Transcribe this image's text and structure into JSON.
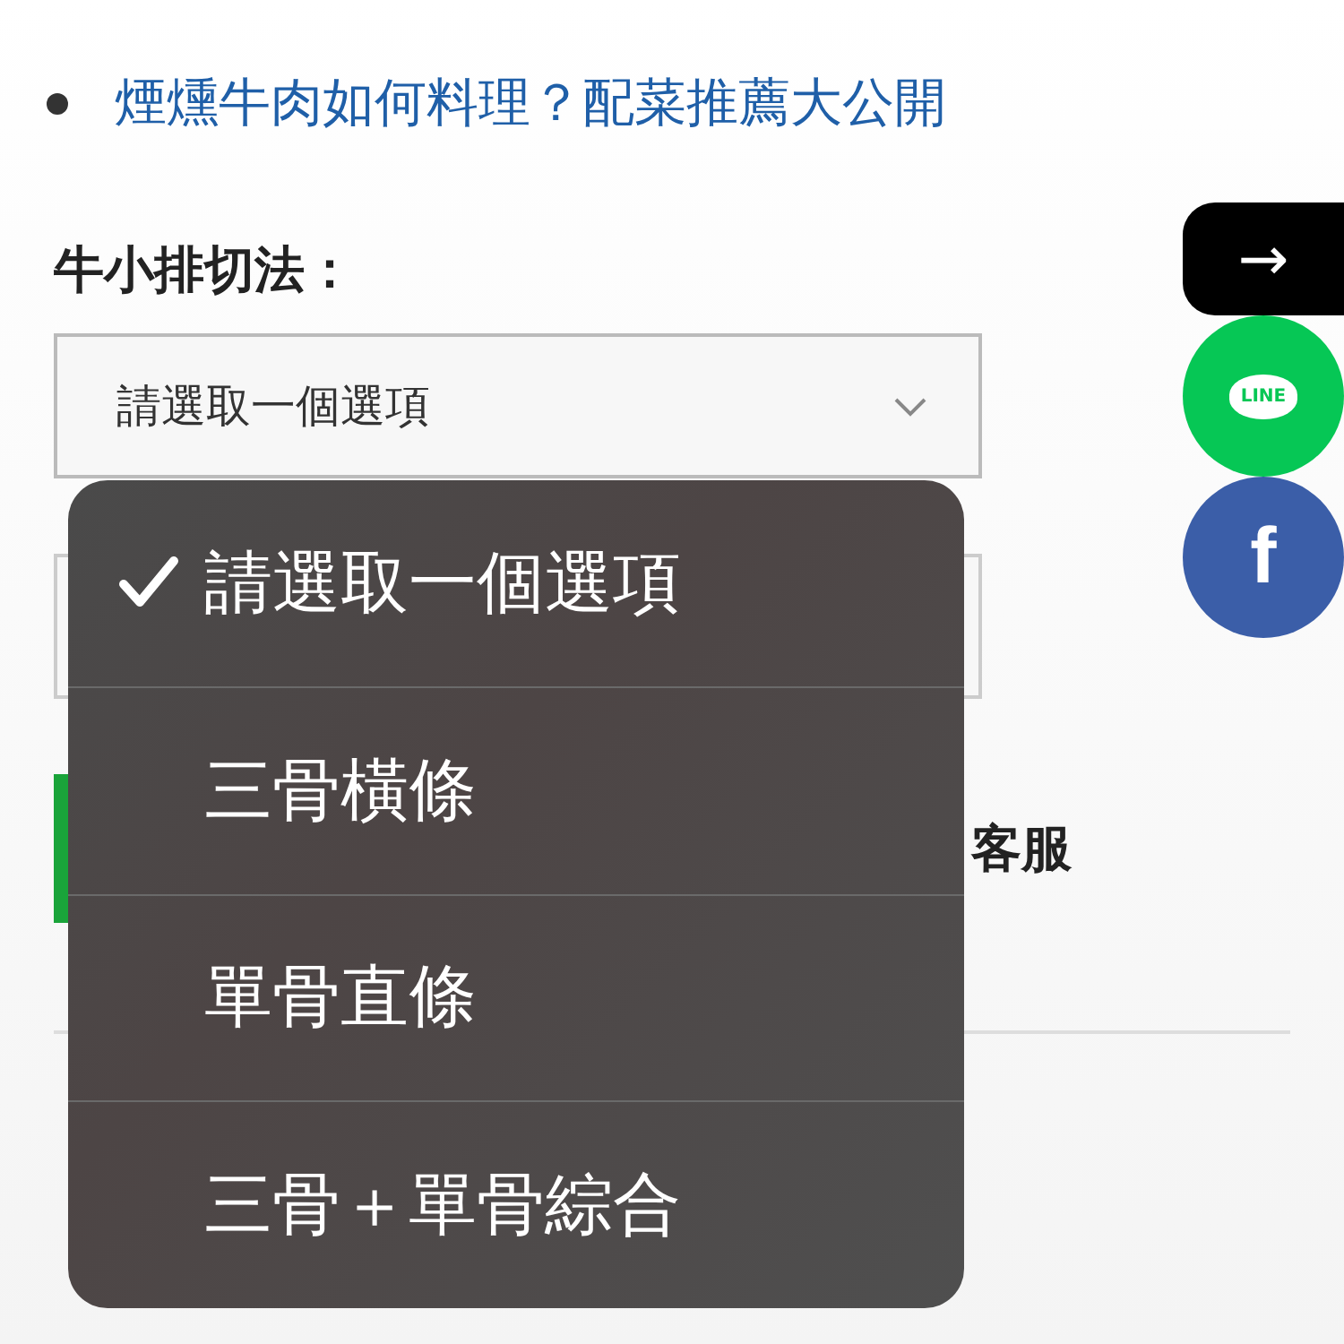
{
  "article": {
    "links": [
      {
        "text": "煙燻牛肉如何料理？配菜推薦大公開"
      }
    ]
  },
  "form": {
    "label": "牛小排切法：",
    "select": {
      "value": "請選取一個選項",
      "expanded": true
    }
  },
  "menu": {
    "options": [
      {
        "label": "請選取一個選項",
        "selected": true
      },
      {
        "label": "三骨橫條",
        "selected": false
      },
      {
        "label": "單骨直條",
        "selected": false
      },
      {
        "label": "三骨＋單骨綜合",
        "selected": false
      }
    ]
  },
  "contact": {
    "text": "客服"
  },
  "share": [
    {
      "kind": "arrow",
      "label": "→"
    },
    {
      "kind": "line",
      "label": "LINE"
    },
    {
      "kind": "facebook",
      "label": "f"
    }
  ]
}
